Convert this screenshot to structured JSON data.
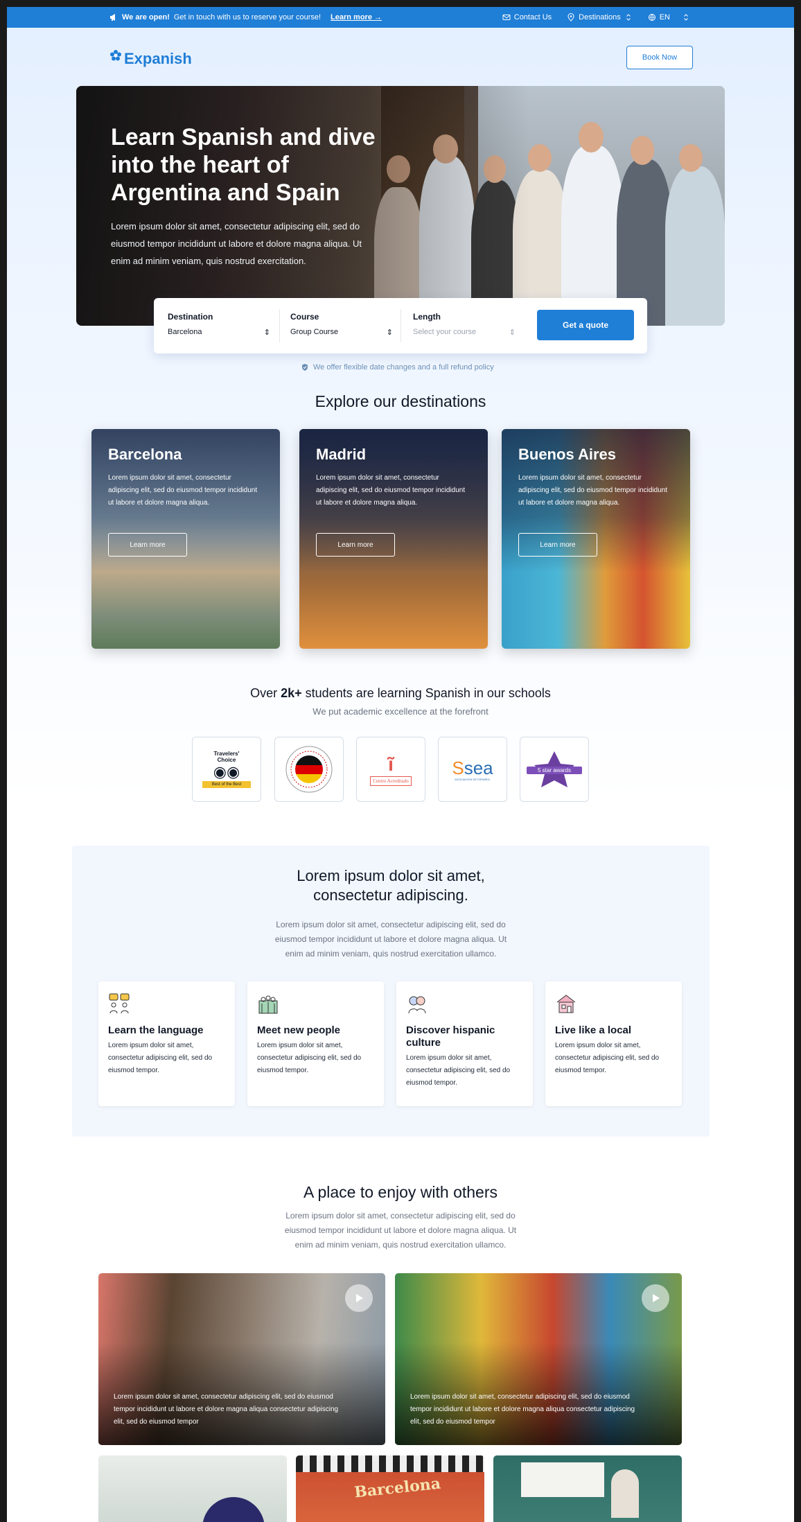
{
  "announcement": {
    "bold": "We are open!",
    "text": "Get in touch with us to reserve your course!",
    "link": "Learn more →"
  },
  "topnav": {
    "contact": "Contact Us",
    "destinations": "Destinations",
    "language": "EN"
  },
  "brand": {
    "name": "Expanish"
  },
  "header": {
    "book_now": "Book Now"
  },
  "hero": {
    "title": "Learn Spanish and dive into the heart of Argentina and Spain",
    "text": "Lorem ipsum dolor sit amet, consectetur adipiscing elit, sed do eiusmod tempor incididunt ut labore et dolore magna aliqua. Ut enim ad minim veniam, quis nostrud exercitation."
  },
  "search": {
    "destination_label": "Destination",
    "destination_value": "Barcelona",
    "course_label": "Course",
    "course_value": "Group Course",
    "length_label": "Length",
    "length_placeholder": "Select your course",
    "cta": "Get a quote"
  },
  "policy": "We offer flexible date changes and a full refund policy",
  "destinations": {
    "title": "Explore our destinations",
    "cards": [
      {
        "name": "Barcelona",
        "text": "Lorem ipsum dolor sit amet, consectetur adipiscing elit, sed do eiusmod tempor incididunt ut labore et dolore magna aliqua.",
        "button": "Learn more"
      },
      {
        "name": "Madrid",
        "text": "Lorem ipsum dolor sit amet, consectetur adipiscing elit, sed do eiusmod tempor incididunt ut labore et dolore magna aliqua.",
        "button": "Learn more"
      },
      {
        "name": "Buenos Aires",
        "text": "Lorem ipsum dolor sit amet, consectetur adipiscing elit, sed do eiusmod tempor incididunt ut labore et dolore magna aliqua.",
        "button": "Learn more"
      }
    ]
  },
  "students": {
    "pre": "Over ",
    "count": "2k+",
    "post": " students are learning Spanish in our schools",
    "subtitle": "We put academic excellence at the forefront"
  },
  "badges": {
    "tripadvisor_line1": "Travelers'",
    "tripadvisor_line2": "Choice",
    "tripadvisor_ribbon": "Best of the Best",
    "cervantes": "Centro Acreditado",
    "sea": "sea",
    "sea_sub": "ASOCIACIÓN DE ESPAÑOL",
    "star": "5 star awards"
  },
  "features": {
    "title_line1": "Lorem ipsum dolor sit amet,",
    "title_line2": "consectetur adipiscing.",
    "lead1": "Lorem ipsum dolor sit amet, consectetur adipiscing elit, sed do",
    "lead2": "eiusmod tempor incididunt ut labore et dolore magna aliqua. Ut",
    "lead3": "enim ad minim veniam, quis nostrud exercitation ullamco.",
    "items": [
      {
        "title": "Learn the language",
        "text": "Lorem ipsum dolor sit amet, consectetur adipiscing elit, sed do eiusmod tempor."
      },
      {
        "title": "Meet new people",
        "text": "Lorem ipsum dolor sit amet, consectetur adipiscing elit, sed do eiusmod tempor."
      },
      {
        "title": "Discover hispanic culture",
        "text": "Lorem ipsum dolor sit amet, consectetur adipiscing elit, sed do eiusmod tempor."
      },
      {
        "title": "Live like a local",
        "text": "Lorem ipsum dolor sit amet, consectetur adipiscing elit, sed do eiusmod tempor."
      }
    ]
  },
  "enjoy": {
    "title": "A place to enjoy with others",
    "lead1": "Lorem ipsum dolor sit amet, consectetur adipiscing elit, sed do",
    "lead2": "eiusmod tempor incididunt ut labore et dolore magna aliqua. Ut",
    "lead3": "enim ad minim veniam, quis nostrud exercitation ullamco.",
    "captions": [
      "Lorem ipsum dolor sit amet, consectetur adipiscing elit, sed do eiusmod tempor incididunt ut labore et dolore magna aliqua consectetur adipiscing elit, sed do eiusmod tempor",
      "Lorem ipsum dolor sit amet, consectetur adipiscing elit, sed do eiusmod tempor incididunt ut labore et dolore magna aliqua consectetur adipiscing elit, sed do eiusmod tempor"
    ],
    "sign_barcelona": "Barcelona"
  },
  "colors": {
    "brand": "#1f7ed6",
    "topbar": "#1f7ed6",
    "text": "#111827",
    "muted": "#6b7280"
  }
}
